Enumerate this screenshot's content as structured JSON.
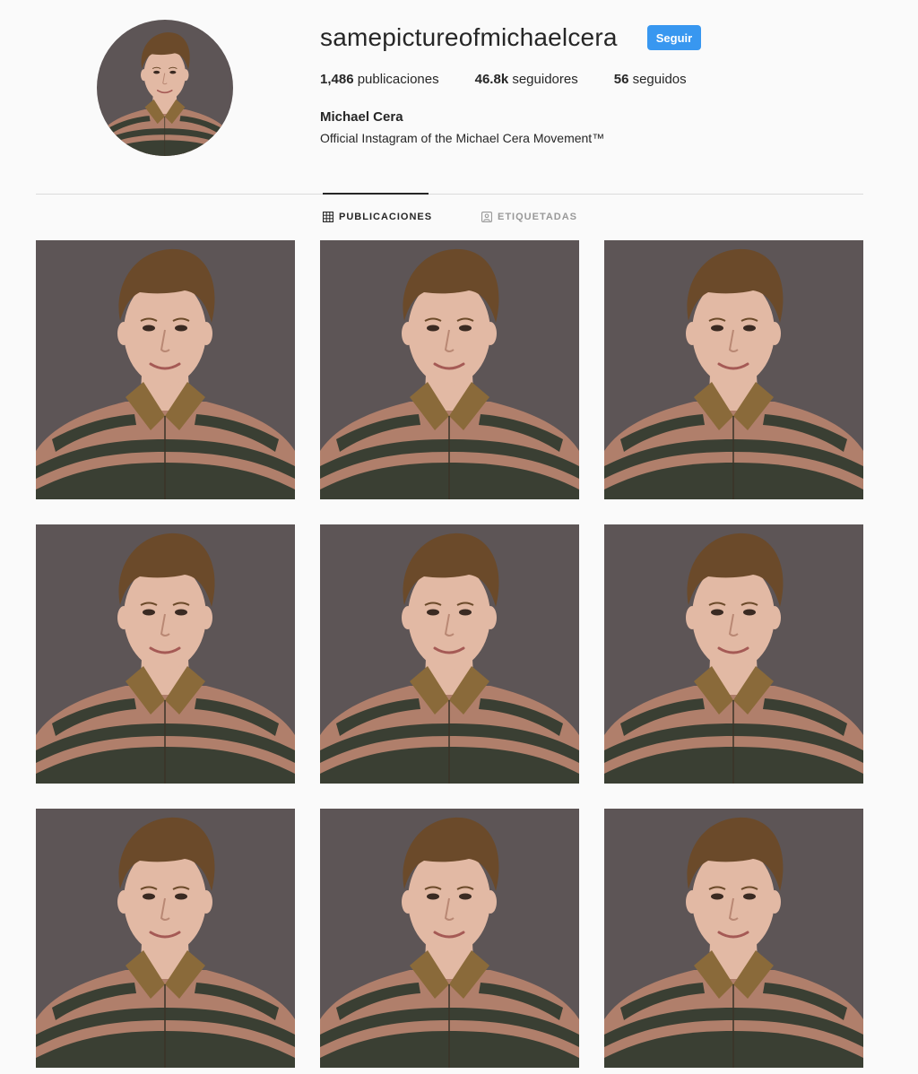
{
  "profile": {
    "username": "samepictureofmichaelcera",
    "follow_label": "Seguir",
    "stats": [
      {
        "value": "1,486",
        "label": "publicaciones"
      },
      {
        "value": "46.8k",
        "label": "seguidores"
      },
      {
        "value": "56",
        "label": "seguidos"
      }
    ],
    "full_name": "Michael Cera",
    "bio": "Official Instagram of the Michael Cera Movement™"
  },
  "tabs": [
    {
      "label": "PUBLICACIONES",
      "icon": "grid-icon",
      "active": true
    },
    {
      "label": "ETIQUETADAS",
      "icon": "tag-icon",
      "active": false
    }
  ],
  "posts": [
    {
      "subject": "Michael Cera portrait"
    },
    {
      "subject": "Michael Cera portrait"
    },
    {
      "subject": "Michael Cera portrait"
    },
    {
      "subject": "Michael Cera portrait"
    },
    {
      "subject": "Michael Cera portrait"
    },
    {
      "subject": "Michael Cera portrait"
    },
    {
      "subject": "Michael Cera portrait"
    },
    {
      "subject": "Michael Cera portrait"
    },
    {
      "subject": "Michael Cera portrait"
    }
  ],
  "colors": {
    "accent": "#3897f0",
    "background": "#fafafa",
    "photo_background": "#5d5556",
    "sweater_pink": "#b07f6b",
    "sweater_green": "#3a3f33",
    "collar": "#8a6a3a",
    "hair": "#6b4a2a",
    "skin": "#e2b9a4"
  }
}
